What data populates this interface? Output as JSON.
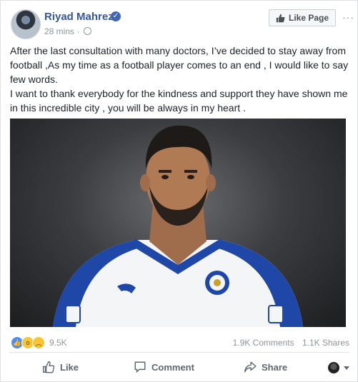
{
  "post": {
    "author": "Riyad Mahrez",
    "timestamp": "28 mins",
    "separator": "·",
    "like_page_label": "Like Page",
    "more_label": "···",
    "paragraphs": [
      "After the last consultation with many doctors, I’ve decided to stay away from football ,As my time as a football player comes to an end , I would like to say few words.",
      "I want to thank everybody for the kindness and support they have shown me in this incredible city , you will be always in my heart ."
    ]
  },
  "reactions": {
    "icons": [
      "like-icon",
      "wow-icon",
      "sad-icon"
    ],
    "count": "9.5K"
  },
  "stats": {
    "comments": "1.9K Comments",
    "shares": "1.1K Shares"
  },
  "actions": {
    "like": "Like",
    "comment": "Comment",
    "share": "Share"
  },
  "colors": {
    "link_blue": "#365899",
    "meta_gray": "#90949c",
    "like_blue": "#4f8cf3"
  }
}
